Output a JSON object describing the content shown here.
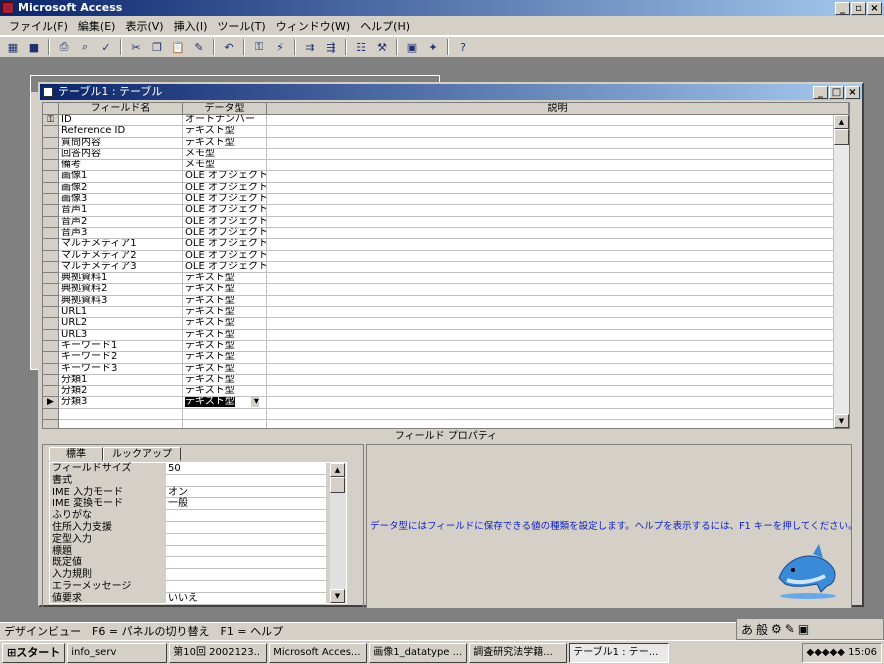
{
  "app": {
    "title": "Microsoft Access"
  },
  "menu": [
    "ファイル(F)",
    "編集(E)",
    "表示(V)",
    "挿入(I)",
    "ツール(T)",
    "ウィンドウ(W)",
    "ヘルプ(H)"
  ],
  "window": {
    "title": "テーブル1 : テーブル"
  },
  "grid": {
    "headers": [
      "フィールド名",
      "データ型",
      "説明"
    ],
    "rows": [
      [
        "ID",
        "オートナンバー"
      ],
      [
        "Reference ID",
        "テキスト型"
      ],
      [
        "質問内容",
        "テキスト型"
      ],
      [
        "回答内容",
        "メモ型"
      ],
      [
        "備考",
        "メモ型"
      ],
      [
        "画像1",
        "OLE オブジェクト"
      ],
      [
        "画像2",
        "OLE オブジェクト"
      ],
      [
        "画像3",
        "OLE オブジェクト"
      ],
      [
        "音声1",
        "OLE オブジェクト"
      ],
      [
        "音声2",
        "OLE オブジェクト"
      ],
      [
        "音声3",
        "OLE オブジェクト"
      ],
      [
        "マルチメディア1",
        "OLE オブジェクト"
      ],
      [
        "マルチメディア2",
        "OLE オブジェクト"
      ],
      [
        "マルチメディア3",
        "OLE オブジェクト"
      ],
      [
        "典拠資料1",
        "テキスト型"
      ],
      [
        "典拠資料2",
        "テキスト型"
      ],
      [
        "典拠資料3",
        "テキスト型"
      ],
      [
        "URL1",
        "テキスト型"
      ],
      [
        "URL2",
        "テキスト型"
      ],
      [
        "URL3",
        "テキスト型"
      ],
      [
        "キーワード1",
        "テキスト型"
      ],
      [
        "キーワード2",
        "テキスト型"
      ],
      [
        "キーワード3",
        "テキスト型"
      ],
      [
        "分類1",
        "テキスト型"
      ],
      [
        "分類2",
        "テキスト型"
      ],
      [
        "分類3",
        "テキスト型"
      ]
    ]
  },
  "field_properties": {
    "label": "フィールド プロパティ",
    "tabs": [
      "標準",
      "ルックアップ"
    ],
    "rows": [
      [
        "フィールドサイズ",
        "50"
      ],
      [
        "書式",
        ""
      ],
      [
        "IME 入力モード",
        "オン"
      ],
      [
        "IME 変換モード",
        "一般"
      ],
      [
        "ふりがな",
        ""
      ],
      [
        "住所入力支援",
        ""
      ],
      [
        "定型入力",
        ""
      ],
      [
        "標題",
        ""
      ],
      [
        "既定値",
        ""
      ],
      [
        "入力規則",
        ""
      ],
      [
        "エラーメッセージ",
        ""
      ],
      [
        "値要求",
        "いいえ"
      ]
    ]
  },
  "help_text": "データ型にはフィールドに保存できる値の種類を設定します。ヘルプを表示するには、F1 キーを押してください。",
  "status": "デザインビュー　F6 = パネルの切り替え　F1 = ヘルプ",
  "ime": [
    "あ",
    "般"
  ],
  "taskbar": {
    "start": "スタート",
    "items": [
      "info_serv",
      "第10回 2002123..",
      "Microsoft Acces...",
      "画像1_datatype ...",
      "調査研究法学籍...",
      "テーブル1 : テー..."
    ],
    "clock": "15:06"
  }
}
